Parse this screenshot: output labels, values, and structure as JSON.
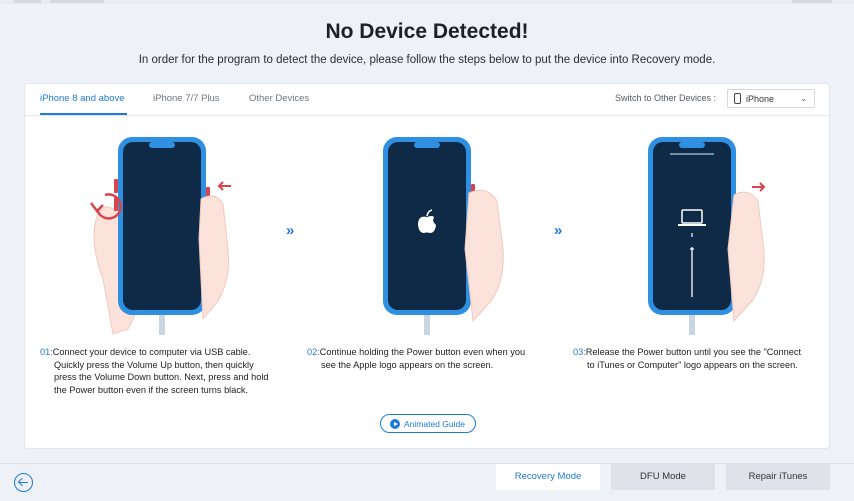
{
  "header": {
    "title": "No Device Detected!",
    "subtitle": "In order for the program to detect the device, please follow the steps below to put the device into Recovery mode."
  },
  "tabs": [
    {
      "label": "iPhone 8 and above",
      "active": true
    },
    {
      "label": "iPhone 7/7 Plus",
      "active": false
    },
    {
      "label": "Other Devices",
      "active": false
    }
  ],
  "switch_device": {
    "label": "Switch to Other Devices :",
    "selected": "iPhone"
  },
  "steps": [
    {
      "num": "01:",
      "lines": [
        "Connect your device to computer via USB cable.",
        "Quickly press the Volume Up button, then quickly",
        "press the Volume Down button. Next, press and hold",
        "the Power button even if the screen turns black."
      ]
    },
    {
      "num": "02:",
      "lines": [
        "Continue holding the Power button even when you",
        "see the Apple logo appears on the screen."
      ]
    },
    {
      "num": "03:",
      "lines": [
        "Release the Power button until you see the \"Connect",
        "to iTunes or Computer\" logo appears on the screen."
      ]
    }
  ],
  "step_arrow": "»",
  "guide_button": "Animated Guide",
  "modes": [
    {
      "label": "Recovery Mode",
      "active": true
    },
    {
      "label": "DFU Mode",
      "active": false
    },
    {
      "label": "Repair iTunes",
      "active": false
    }
  ],
  "colors": {
    "accent": "#1f7ad8",
    "phone_body": "#2f8fe0",
    "phone_screen": "#0e2a47",
    "red_arrow": "#d9434b",
    "hand": "#fbe3dc"
  }
}
